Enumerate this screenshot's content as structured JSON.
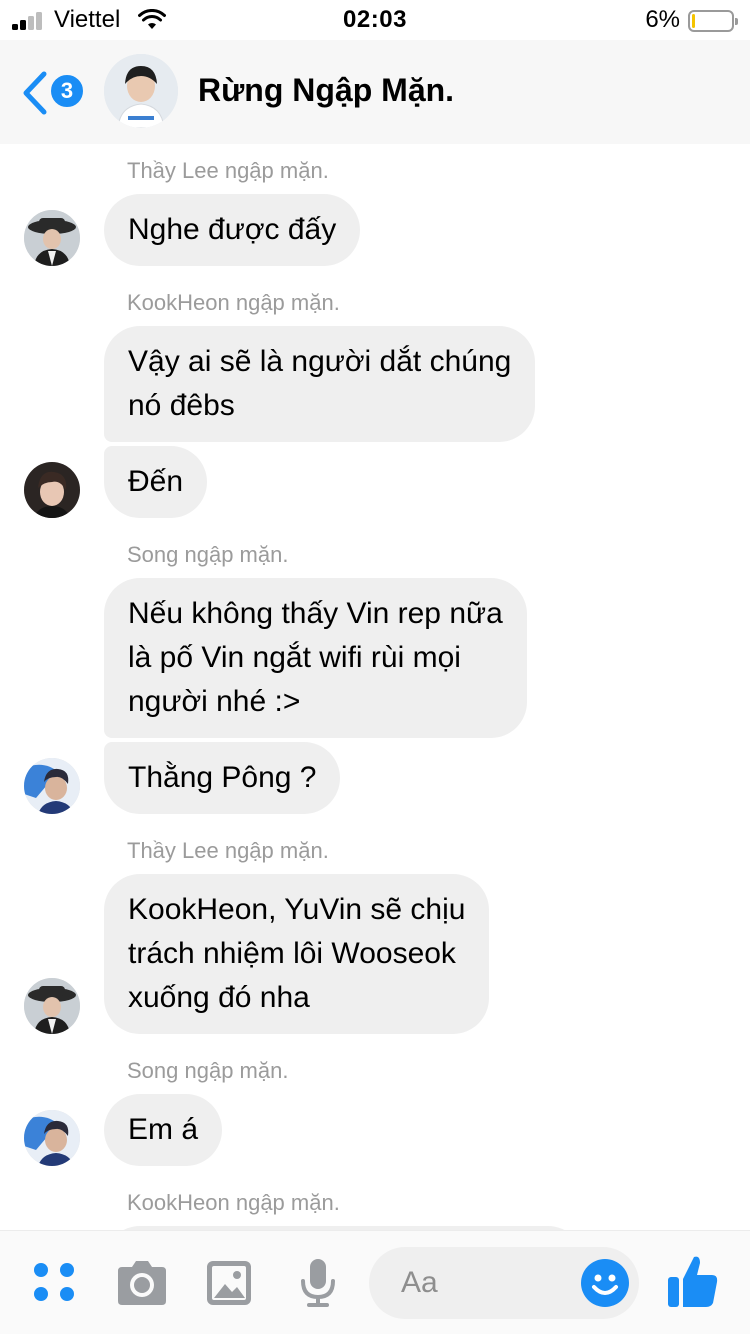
{
  "status_bar": {
    "carrier": "Viettel",
    "time": "02:03",
    "battery": "6%",
    "battery_level": 0.06
  },
  "header": {
    "unread_count": "3",
    "title": "Rừng Ngập Mặn."
  },
  "messages": [
    {
      "sender": "Thầy Lee ngập mặn.",
      "text": "Nghe được đấy"
    },
    {
      "sender": "KookHeon ngập mặn.",
      "text": "Vậy ai sẽ là người dắt chúng\nnó đêbs"
    },
    {
      "sender": "",
      "text": "Đến"
    },
    {
      "sender": "Song ngập mặn.",
      "text": "Nếu không thấy Vin rep nữa\nlà pố Vin ngắt wifi rùi mọi\nngười nhé :>"
    },
    {
      "sender": "",
      "text": "Thằng Pông ?"
    },
    {
      "sender": "Thầy Lee ngập mặn.",
      "text": "KookHeon, YuVin sẽ chịu\ntrách nhiệm lôi Wooseok\nxuống đó nha"
    },
    {
      "sender": "Song ngập mặn.",
      "text": "Em á"
    },
    {
      "sender": "KookHeon ngập mặn.",
      "text": ""
    }
  ],
  "composer": {
    "placeholder": "Aa",
    "icons": [
      "menu-dots-icon",
      "camera-icon",
      "gallery-icon",
      "microphone-icon",
      "emoji-icon",
      "thumbs-up-icon"
    ],
    "accent_color": "#1a8df5"
  }
}
